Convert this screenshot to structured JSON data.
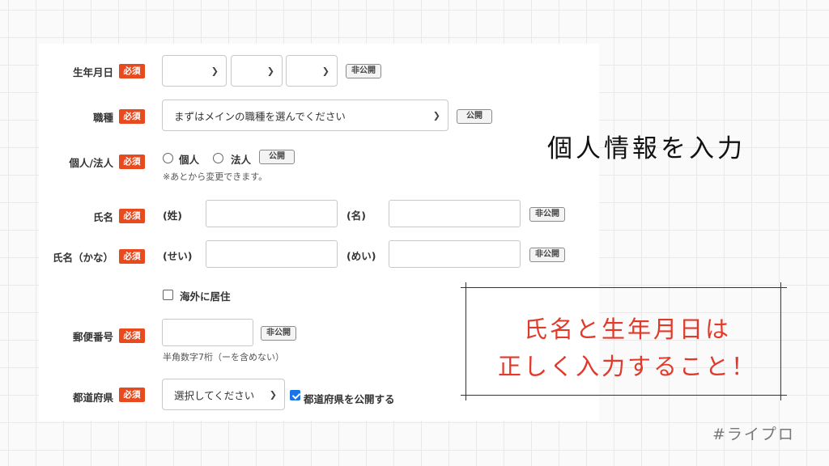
{
  "required_badge": "必須",
  "birthdate": {
    "label": "生年月日",
    "visibility": "非公開"
  },
  "occupation": {
    "label": "職種",
    "placeholder": "まずはメインの職種を選んでください",
    "visibility": "公開"
  },
  "entity": {
    "label": "個人/法人",
    "options": [
      "個人",
      "法人"
    ],
    "visibility": "公開",
    "hint": "※あとから変更できます。"
  },
  "name": {
    "label": "氏名",
    "last_label": "(姓)",
    "first_label": "(名)",
    "visibility": "非公開"
  },
  "name_kana": {
    "label": "氏名（かな）",
    "last_label": "(せい)",
    "first_label": "(めい)",
    "visibility": "非公開"
  },
  "overseas": {
    "label": "海外に居住",
    "checked": false
  },
  "postal": {
    "label": "郵便番号",
    "visibility": "非公開",
    "hint": "半角数字7桁（ーを含めない）"
  },
  "prefecture": {
    "label": "都道府県",
    "placeholder": "選択してください",
    "publish_label": "都道府県を公開する",
    "publish_checked": true
  },
  "annotation": {
    "caption": "個人情報を入力",
    "note_line1": "氏名と生年月日は",
    "note_line2": "正しく入力すること！",
    "note_color": "#e23a2a"
  },
  "hashtag": "#ライプロ",
  "colors": {
    "required_badge": "#e8491d",
    "checkbox_accent": "#1a73e8"
  }
}
